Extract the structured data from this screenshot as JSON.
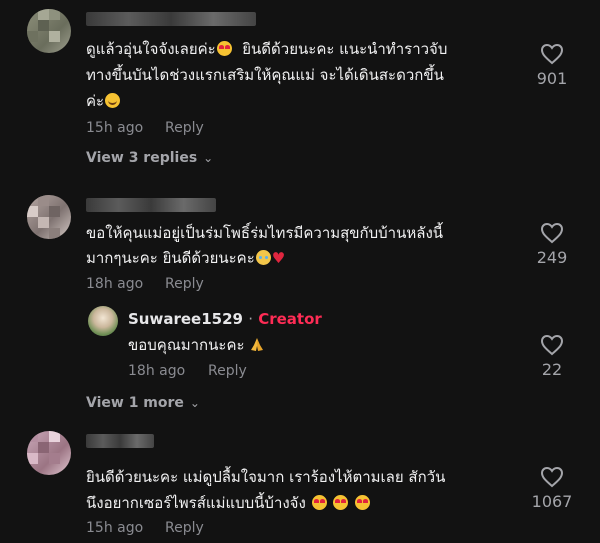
{
  "comments": [
    {
      "line1": "ดูแล้วอุ่นใจจังเลยค่ะ",
      "line1b": "ยินดีด้วยนะคะ แนะนำทำราวจับ",
      "line2": "ทางขึ้นบันไดช่วงแรกเสริมให้คุณแม่ จะได้เดินสะดวกขึ้น",
      "line3": "ค่ะ",
      "time": "15h ago",
      "reply": "Reply",
      "likes": "901",
      "view_replies": "View 3 replies"
    },
    {
      "line1": "ขอให้คุนแม่อยู่เป็นร่มโพธิ์ร่มไทรมีความสุขกับบ้านหลังนี้",
      "line2": "มากๆนะคะ ยินดีด้วยนะคะ",
      "time": "18h ago",
      "reply": "Reply",
      "likes": "249",
      "view_more": "View 1 more"
    },
    {
      "line1": "ยินดีด้วยนะคะ แม่ดูปลื้มใจมาก เราร้องไห้ตามเลย สักวัน",
      "line2": "นึงอยากเซอร์ไพรส์แม่แบบนี้บ้างจัง",
      "time": "15h ago",
      "reply": "Reply",
      "likes": "1067"
    }
  ],
  "creator_reply": {
    "username": "Suwaree1529",
    "separator": "·",
    "badge": "Creator",
    "text": "ขอบคุณมากนะคะ",
    "time": "18h ago",
    "reply": "Reply",
    "likes": "22"
  },
  "icons": {
    "heart": "heart-outline-icon",
    "chevron": "chevron-down-icon"
  },
  "colors": {
    "background": "#121212",
    "creator_badge": "#fe2c55",
    "muted_text": "#8a8b91"
  }
}
